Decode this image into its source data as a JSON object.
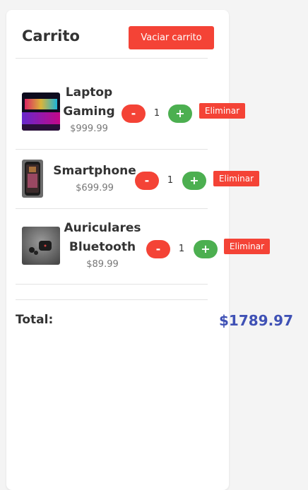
{
  "cart": {
    "title": "Carrito",
    "clear_label": "Vaciar carrito",
    "currency_total_label": "Total:",
    "total": "$1789.97",
    "items": [
      {
        "name_line1": "Laptop",
        "name_line2": "Gaming",
        "price": "$999.99",
        "quantity": "1",
        "minus_label": "-",
        "plus_label": "+",
        "remove_label": "Eliminar"
      },
      {
        "name_line1": "Smartphone",
        "name_line2": "",
        "price": "$699.99",
        "quantity": "1",
        "minus_label": "-",
        "plus_label": "+",
        "remove_label": "Eliminar"
      },
      {
        "name_line1": "Auriculares",
        "name_line2": "Bluetooth",
        "price": "$89.99",
        "quantity": "1",
        "minus_label": "-",
        "plus_label": "+",
        "remove_label": "Eliminar"
      }
    ]
  },
  "colors": {
    "danger": "#f44336",
    "success": "#4caf50",
    "total": "#3f51b5"
  }
}
